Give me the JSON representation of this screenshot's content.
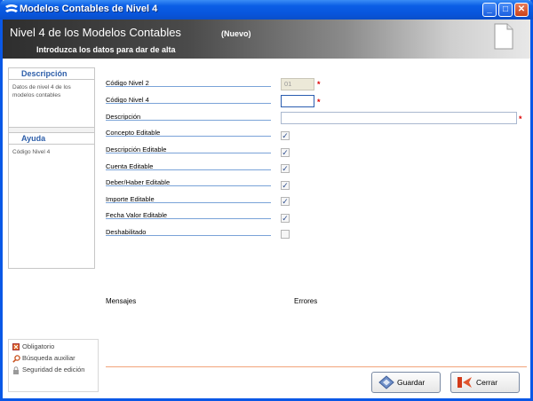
{
  "window": {
    "title": "Modelos Contables de Nivel 4",
    "min_label": "_",
    "max_label": "□",
    "close_label": "✕"
  },
  "header": {
    "title": "Nivel 4 de los Modelos Contables",
    "badge": "(Nuevo)",
    "subtitle": "Introduzca los datos para dar de alta"
  },
  "sidebar": {
    "description_title": "Descripción",
    "description_text": "Datos de nivel 4 de los modelos contables",
    "help_title": "Ayuda",
    "help_text": "Código Nivel 4"
  },
  "legend": {
    "required": "Obligatorio",
    "search": "Búsqueda auxiliar",
    "security": "Seguridad de edición"
  },
  "form": {
    "codigo_nivel2": {
      "label": "Código Nivel 2",
      "value": "01",
      "required_mark": "*"
    },
    "codigo_nivel4": {
      "label": "Código Nivel 4",
      "value": "",
      "required_mark": "*"
    },
    "descripcion": {
      "label": "Descripción",
      "value": "",
      "required_mark": "*"
    },
    "checkboxes": [
      {
        "label": "Concepto Editable",
        "checked": true,
        "mark": "✓"
      },
      {
        "label": "Descripción Editable",
        "checked": true,
        "mark": "✓"
      },
      {
        "label": "Cuenta Editable",
        "checked": true,
        "mark": "✓"
      },
      {
        "label": "Deber/Haber Editable",
        "checked": true,
        "mark": "✓"
      },
      {
        "label": "Importe Editable",
        "checked": true,
        "mark": "✓"
      },
      {
        "label": "Fecha Valor Editable",
        "checked": true,
        "mark": "✓"
      },
      {
        "label": "Deshabilitado",
        "checked": false,
        "mark": ""
      }
    ]
  },
  "messages": {
    "messages_label": "Mensajes",
    "errors_label": "Errores"
  },
  "buttons": {
    "save": "Guardar",
    "close": "Cerrar"
  },
  "colors": {
    "titlebar": "#0a5ee6",
    "section_title": "#2d5ea9",
    "required": "#dd0000",
    "separator": "#f2a37a"
  }
}
